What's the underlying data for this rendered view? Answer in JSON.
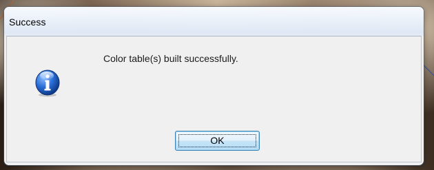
{
  "dialog": {
    "title": "Success",
    "message": "Color table(s) built successfully.",
    "icon": "info-icon",
    "ok_label": "OK"
  },
  "colors": {
    "accent_border": "#3c7fb1",
    "icon_blue": "#1d5bbf"
  }
}
